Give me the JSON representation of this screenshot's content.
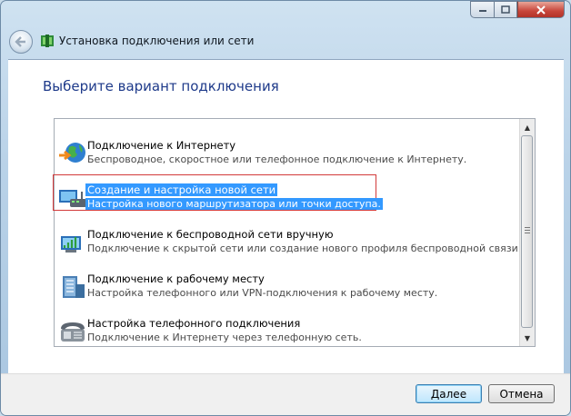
{
  "window": {
    "title": "Установка подключения или сети"
  },
  "main": {
    "heading": "Выберите вариант подключения",
    "options": [
      {
        "title": "Подключение к Интернету",
        "description": "Беспроводное, скоростное или телефонное подключение к Интернету.",
        "icon": "globe-network-icon",
        "selected": false
      },
      {
        "title": "Создание и настройка новой сети",
        "description": "Настройка нового маршрутизатора или точки доступа.",
        "icon": "router-network-icon",
        "selected": true
      },
      {
        "title": "Подключение к беспроводной сети вручную",
        "description": "Подключение к скрытой сети или создание нового профиля беспроводной связи.",
        "icon": "wireless-network-icon",
        "selected": false
      },
      {
        "title": "Подключение к рабочему месту",
        "description": "Настройка телефонного или VPN-подключения к рабочему месту.",
        "icon": "workplace-vpn-icon",
        "selected": false
      },
      {
        "title": "Настройка телефонного подключения",
        "description": "Подключение к Интернету через телефонную сеть.",
        "icon": "dialup-phone-icon",
        "selected": false
      }
    ]
  },
  "footer": {
    "next_label": "Далее",
    "cancel_label": "Отмена"
  },
  "colors": {
    "heading": "#1e3a8a",
    "selection": "#3399ff",
    "focus_outline": "#d23a3a"
  }
}
